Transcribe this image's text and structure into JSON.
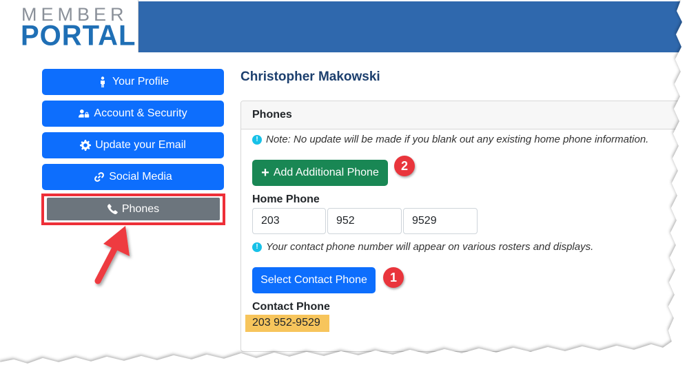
{
  "logo": {
    "line1": "MEMBER",
    "line2": "PORTAL"
  },
  "sidebar": {
    "items": [
      {
        "label": "Your Profile",
        "icon": "person-icon"
      },
      {
        "label": "Account & Security",
        "icon": "user-lock-icon"
      },
      {
        "label": "Update your Email",
        "icon": "gear-icon"
      },
      {
        "label": "Social Media",
        "icon": "link-icon"
      },
      {
        "label": "Phones",
        "icon": "phone-icon",
        "active": true
      }
    ]
  },
  "main": {
    "user_name": "Christopher Makowski",
    "card_title": "Phones",
    "note1": "Note: No update will be made if you blank out any existing home phone information.",
    "add_phone_label": "Add Additional Phone",
    "home_phone_label": "Home Phone",
    "home_phone": {
      "area": "203",
      "prefix": "952",
      "line": "9529"
    },
    "note2": "Your contact phone number will appear on various rosters and displays.",
    "select_contact_label": "Select Contact Phone",
    "contact_phone_label": "Contact Phone",
    "contact_phone_value": "203 952-9529"
  },
  "annotations": {
    "step1": "1",
    "step2": "2"
  },
  "colors": {
    "primary": "#0d6efd",
    "success": "#198754",
    "secondary": "#6c757d",
    "banner": "#2f68ad",
    "highlight": "#f7c55c",
    "annotation_red": "#ee2f38"
  }
}
